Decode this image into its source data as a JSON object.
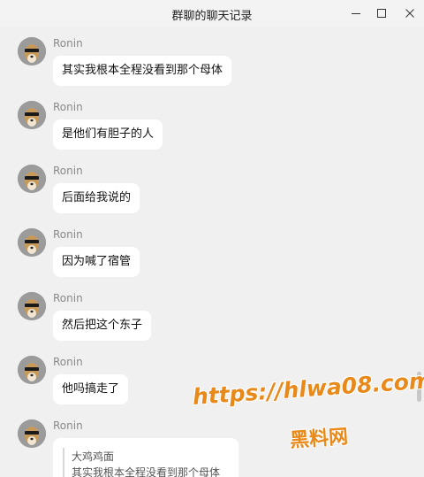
{
  "window": {
    "title": "群聊的聊天记录",
    "controls": {
      "minimize": "minimize-icon",
      "maximize": "maximize-icon",
      "close": "close-icon"
    }
  },
  "messages": [
    {
      "sender": "Ronin",
      "text": "其实我根本全程没看到那个母体"
    },
    {
      "sender": "Ronin",
      "text": "是他们有胆子的人"
    },
    {
      "sender": "Ronin",
      "text": "后面给我说的"
    },
    {
      "sender": "Ronin",
      "text": "因为喊了宿管"
    },
    {
      "sender": "Ronin",
      "text": "然后把这个东子"
    },
    {
      "sender": "Ronin",
      "text": "他吗搞走了"
    },
    {
      "sender": "Ronin",
      "quote": {
        "author": "大鸡鸡面",
        "text": "其实我根本全程没看到那个母体"
      }
    }
  ],
  "watermark": {
    "url": "https://hlwa08.com",
    "name": "黑料网"
  },
  "colors": {
    "background": "#f0f0f0",
    "bubble": "#ffffff",
    "watermark": "#e8891a"
  }
}
